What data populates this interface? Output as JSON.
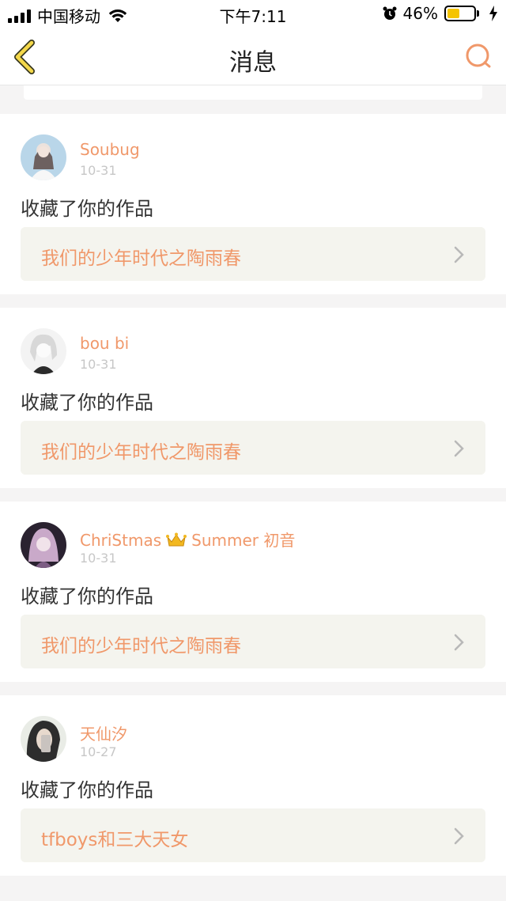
{
  "status_bar": {
    "carrier": "中国移动",
    "time": "下午7:11",
    "battery_percent": "46%",
    "battery_level": 0.46,
    "battery_color": "#f5c400"
  },
  "nav": {
    "title": "消息",
    "back_icon": "chevron-left-icon",
    "search_icon": "search-icon",
    "accent": "#f0986a"
  },
  "messages": [
    {
      "username": "Soubug",
      "date": "10-31",
      "action": "收藏了你的作品",
      "work_title": "我们的少年时代之陶雨春"
    },
    {
      "username": "bou bi",
      "date": "10-31",
      "action": "收藏了你的作品",
      "work_title": "我们的少年时代之陶雨春"
    },
    {
      "username_part1": "ChriStmas",
      "username_part2": "Summer 初音",
      "date": "10-31",
      "action": "收藏了你的作品",
      "work_title": "我们的少年时代之陶雨春"
    },
    {
      "username": "天仙汐",
      "date": "10-27",
      "action": "收藏了你的作品",
      "work_title": "tfboys和三大天女"
    }
  ]
}
